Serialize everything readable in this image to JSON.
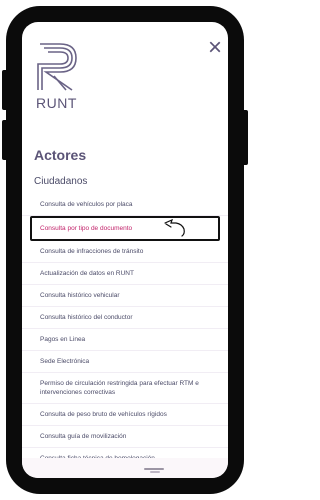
{
  "header": {
    "brand": "RUNT",
    "close_glyph": "×"
  },
  "nav": {
    "section_title": "Actores",
    "group_title": "Ciudadanos",
    "items": [
      {
        "label": "Consulta de vehículos por placa"
      },
      {
        "label": "Consulta por tipo de documento"
      },
      {
        "label": "Consulta de infracciones de tránsito"
      },
      {
        "label": "Actualización de datos en RUNT"
      },
      {
        "label": "Consulta histórico vehicular"
      },
      {
        "label": "Consulta histórico del conductor"
      },
      {
        "label": "Pagos en Linea"
      },
      {
        "label": "Sede Electrónica"
      },
      {
        "label": "Permiso de circulación restringida para efectuar RTM e intervenciones correctivas"
      },
      {
        "label": "Consulta de peso bruto de vehículos rígidos"
      },
      {
        "label": "Consulta guía de movilización"
      },
      {
        "label": "Consulta ficha técnica de homologación"
      }
    ]
  },
  "colors": {
    "accent": "#c2226a",
    "brand": "#5b5477",
    "text": "#4b4b68"
  },
  "icons": {
    "logo": "runt-logo-icon",
    "close": "close-icon",
    "pointer": "hand-pointer-icon"
  }
}
